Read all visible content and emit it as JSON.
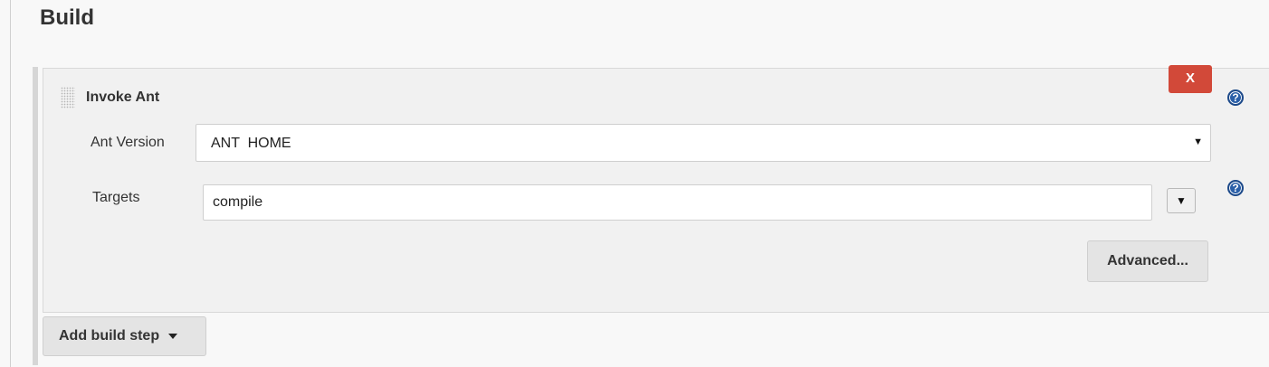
{
  "section": {
    "title": "Build"
  },
  "build_step": {
    "title": "Invoke Ant",
    "delete_label": "X",
    "ant_version": {
      "label": "Ant Version",
      "selected": "ANT  HOME",
      "arrow": "▼"
    },
    "targets": {
      "label": "Targets",
      "value": "compile",
      "expand_glyph": "▼"
    },
    "advanced_label": "Advanced..."
  },
  "add_build_step": {
    "label": "Add build step"
  },
  "help": {
    "glyph": "?"
  },
  "colors": {
    "delete_button": "#d24939",
    "help_icon": "#2a5fa8",
    "panel_background": "#f1f1f1",
    "page_background": "#f8f8f8"
  }
}
